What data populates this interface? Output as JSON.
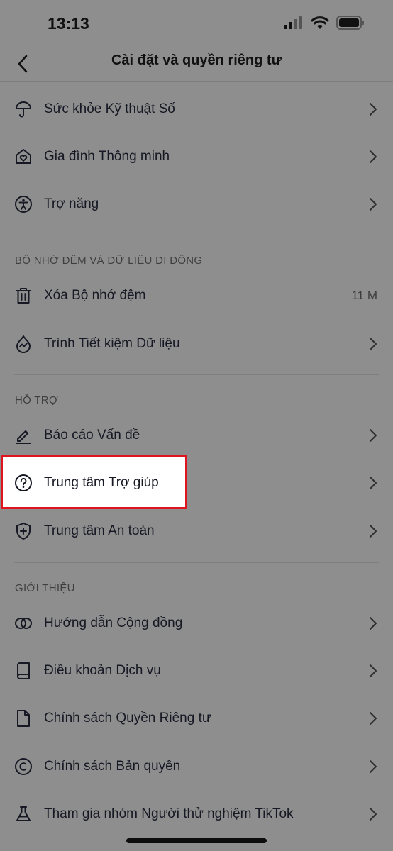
{
  "status": {
    "time": "13:13"
  },
  "nav": {
    "title": "Cài đặt và quyền riêng tư"
  },
  "rows_top": [
    {
      "label": "Sức khỏe Kỹ thuật Số",
      "icon": "umbrella-icon"
    },
    {
      "label": "Gia đình Thông minh",
      "icon": "family-home-icon"
    },
    {
      "label": "Trợ năng",
      "icon": "accessibility-icon"
    }
  ],
  "sections": {
    "cache": {
      "header": "BỘ NHỚ ĐỆM VÀ DỮ LIỆU DI ĐỘNG",
      "clear_cache": {
        "label": "Xóa Bộ nhớ đệm",
        "value": "11 M",
        "icon": "trash-icon"
      },
      "data_saver": {
        "label": "Trình Tiết kiệm Dữ liệu",
        "icon": "data-saver-icon"
      }
    },
    "support": {
      "header": "HỖ TRỢ",
      "items": [
        {
          "label": "Báo cáo Vấn đề",
          "icon": "pencil-icon"
        },
        {
          "label": "Trung tâm Trợ giúp",
          "icon": "question-circle-icon"
        },
        {
          "label": "Trung tâm An toàn",
          "icon": "shield-plus-icon"
        }
      ]
    },
    "about": {
      "header": "GIỚI THIỆU",
      "items": [
        {
          "label": "Hướng dẫn Cộng đồng",
          "icon": "rings-icon"
        },
        {
          "label": "Điều khoản Dịch vụ",
          "icon": "book-icon"
        },
        {
          "label": "Chính sách Quyền Riêng tư",
          "icon": "document-icon"
        },
        {
          "label": "Chính sách Bản quyền",
          "icon": "copyright-icon"
        },
        {
          "label": "Tham gia nhóm Người thử nghiệm TikTok",
          "icon": "flask-icon"
        }
      ]
    }
  },
  "colors": {
    "overlay": "#8e8e8e",
    "highlight_border": "#e0141e",
    "text": "#161823"
  }
}
